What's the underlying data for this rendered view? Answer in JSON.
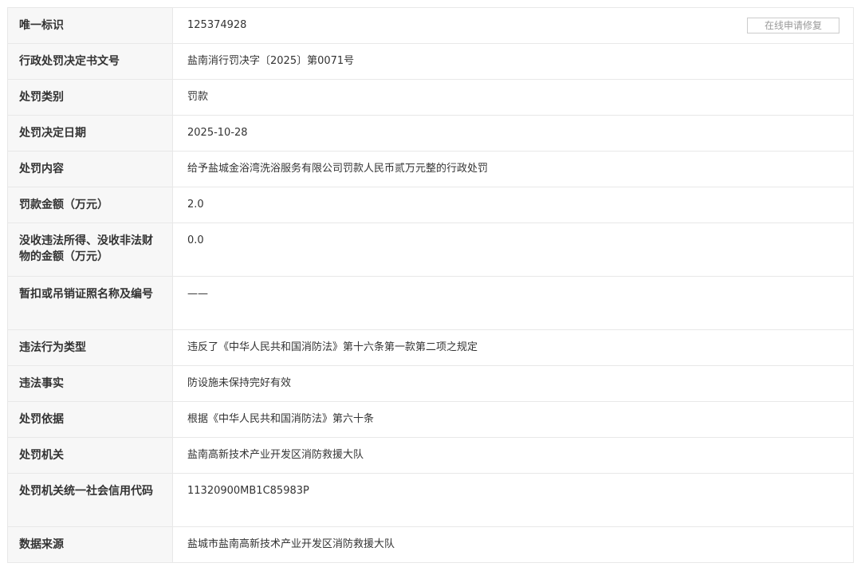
{
  "record": {
    "repair_button_label": "在线申请修复",
    "rows": [
      {
        "label": "唯一标识",
        "value": "125374928"
      },
      {
        "label": "行政处罚决定书文号",
        "value": "盐南消行罚决字〔2025〕第0071号"
      },
      {
        "label": "处罚类别",
        "value": "罚款"
      },
      {
        "label": "处罚决定日期",
        "value": "2025-10-28"
      },
      {
        "label": "处罚内容",
        "value": "给予盐城金浴湾洗浴服务有限公司罚款人民币贰万元整的行政处罚"
      },
      {
        "label": "罚款金额（万元）",
        "value": "2.0"
      },
      {
        "label": "没收违法所得、没收非法财物的金额（万元）",
        "value": "0.0"
      },
      {
        "label": "暂扣或吊销证照名称及编号",
        "value": "——"
      },
      {
        "label": "违法行为类型",
        "value": "违反了《中华人民共和国消防法》第十六条第一款第二项之规定"
      },
      {
        "label": "违法事实",
        "value": "防设施未保持完好有效"
      },
      {
        "label": "处罚依据",
        "value": "根据《中华人民共和国消防法》第六十条"
      },
      {
        "label": "处罚机关",
        "value": "盐南高新技术产业开发区消防救援大队"
      },
      {
        "label": "处罚机关统一社会信用代码",
        "value": "11320900MB1C85983P"
      },
      {
        "label": "数据来源",
        "value": "盐城市盐南高新技术产业开发区消防救援大队"
      }
    ]
  }
}
